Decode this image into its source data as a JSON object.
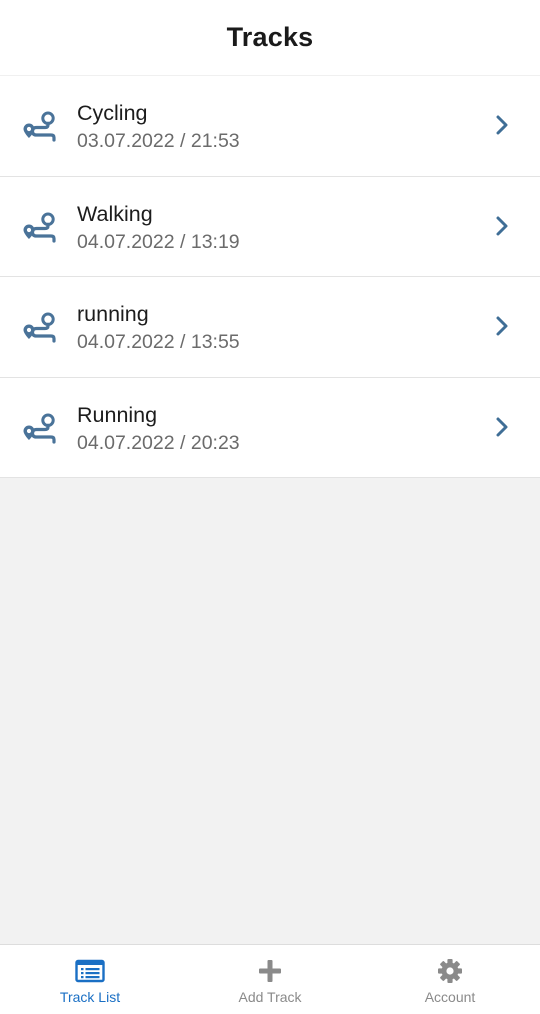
{
  "header": {
    "title": "Tracks"
  },
  "tracks": [
    {
      "name": "Cycling",
      "datetime": "03.07.2022 / 21:53",
      "icon": "route-icon"
    },
    {
      "name": "Walking",
      "datetime": "04.07.2022 / 13:19",
      "icon": "route-icon"
    },
    {
      "name": "running",
      "datetime": "04.07.2022 / 13:55",
      "icon": "route-icon"
    },
    {
      "name": "Running",
      "datetime": "04.07.2022 / 20:23",
      "icon": "route-icon"
    }
  ],
  "nav": {
    "items": [
      {
        "label": "Track List",
        "icon": "list-icon",
        "active": true
      },
      {
        "label": "Add Track",
        "icon": "plus-icon",
        "active": false
      },
      {
        "label": "Account",
        "icon": "gear-icon",
        "active": false
      }
    ]
  },
  "colors": {
    "accent": "#1a6fc4",
    "route_icon": "#4a7399",
    "inactive": "#8a8a8a"
  }
}
